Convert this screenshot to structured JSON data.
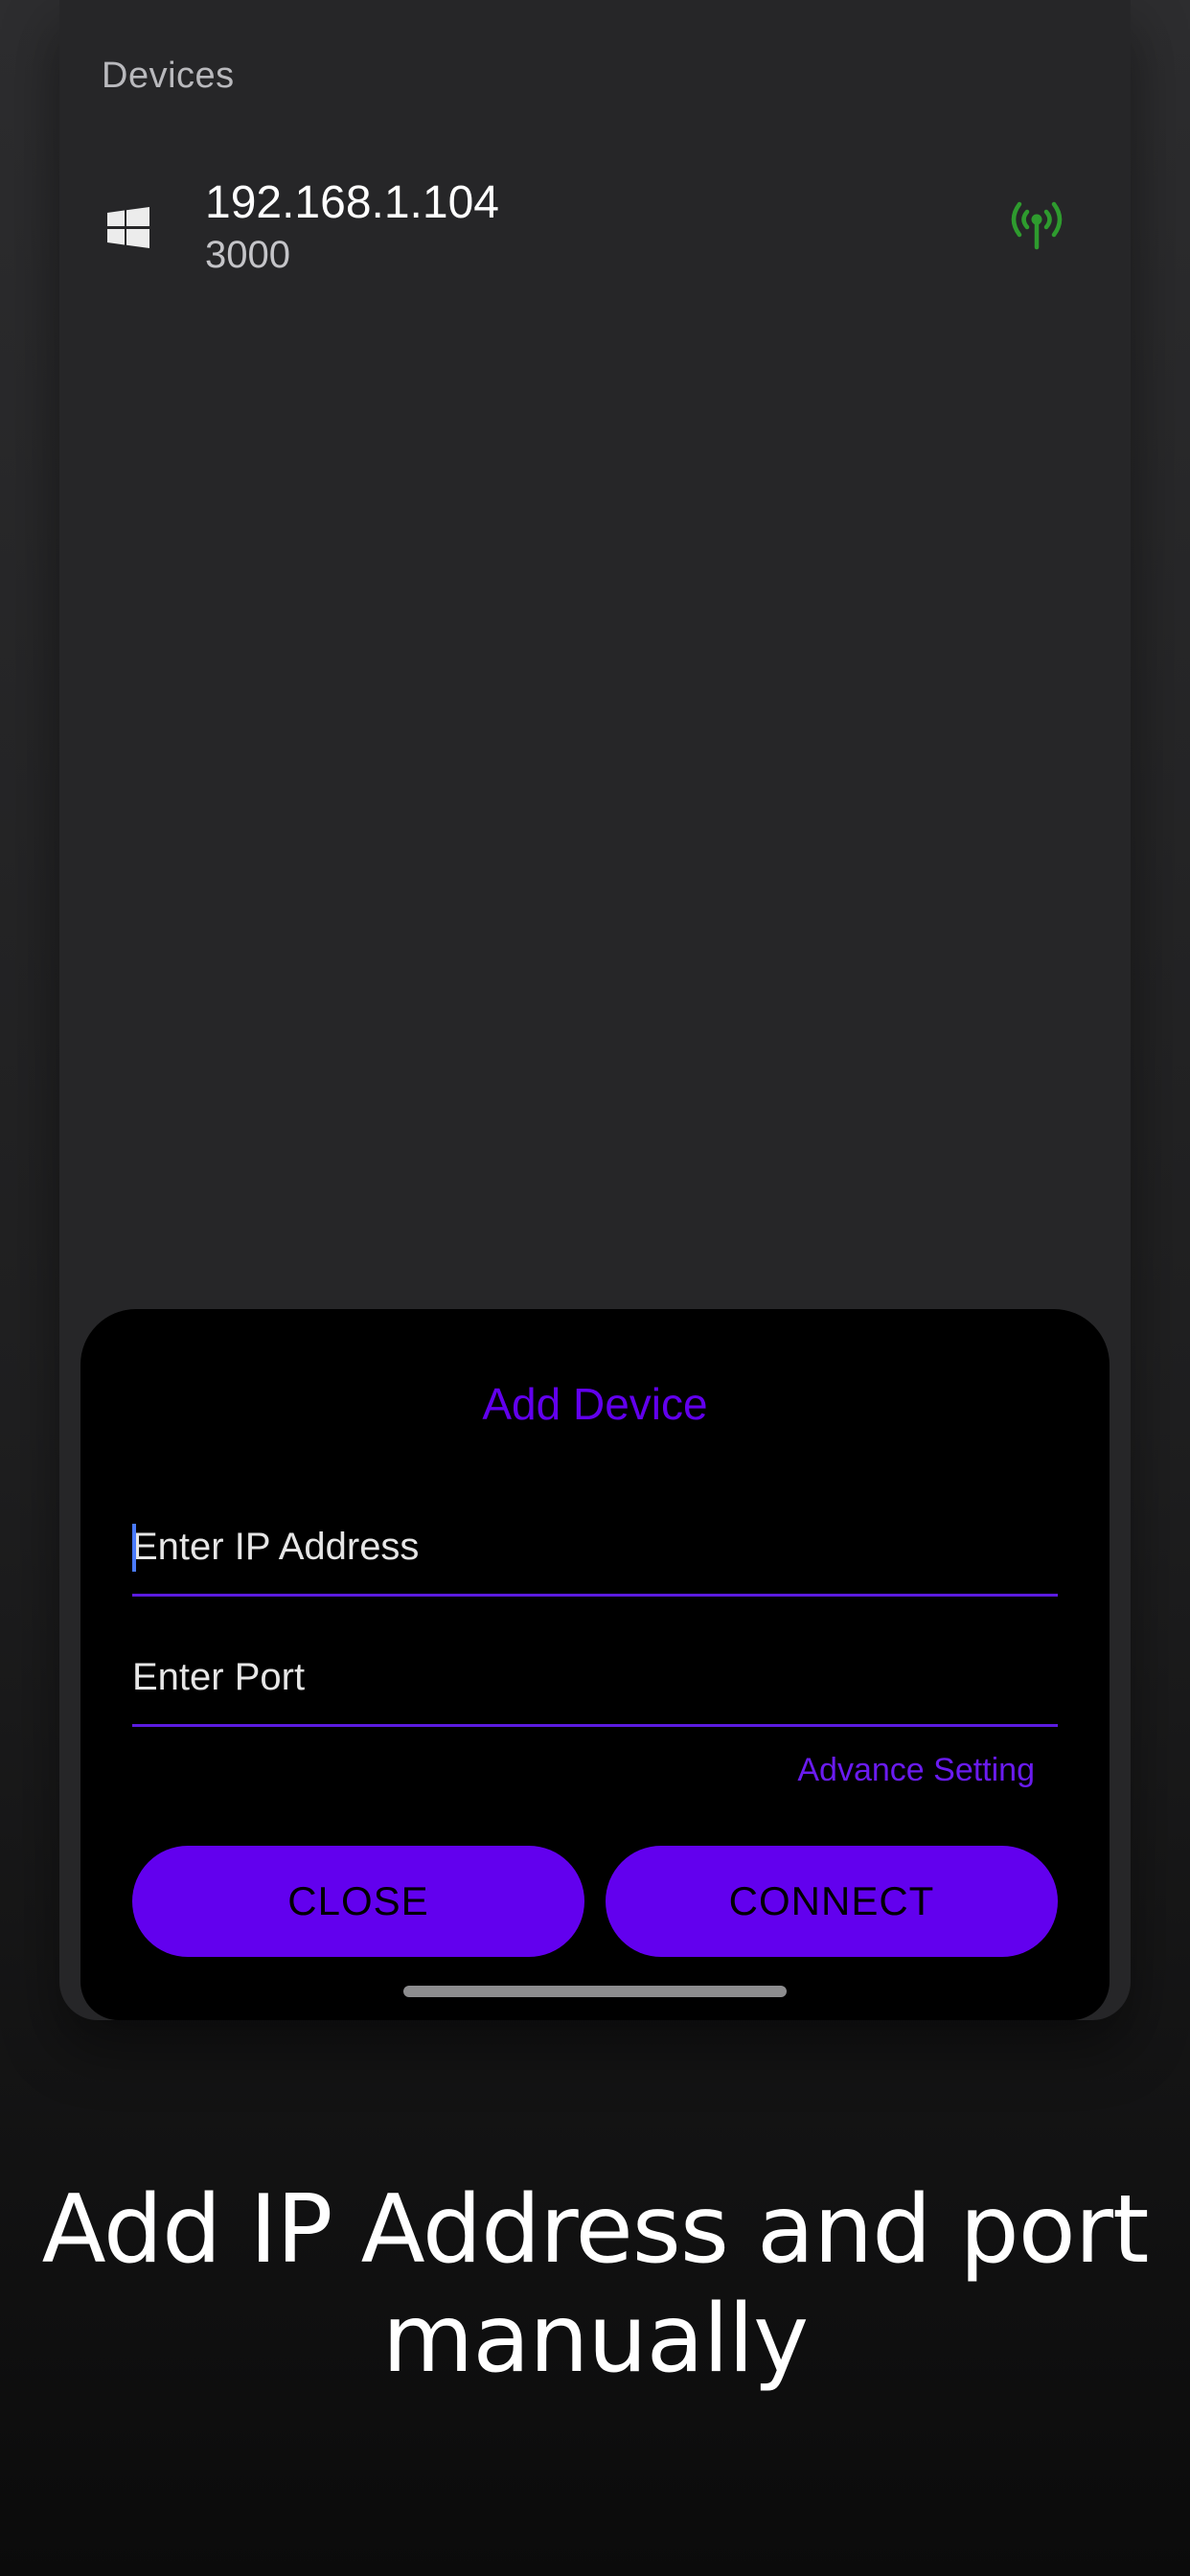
{
  "screen": {
    "section_title": "Devices"
  },
  "device": {
    "ip": "192.168.1.104",
    "port": "3000",
    "os_icon": "windows-icon",
    "status_icon": "signal-antenna-icon",
    "status_color": "#2e9b2e"
  },
  "dialog": {
    "title": "Add Device",
    "ip_placeholder": "Enter IP Address",
    "ip_value": "",
    "port_placeholder": "Enter Port",
    "port_value": "",
    "advance_setting": "Advance Setting",
    "close_label": "CLOSE",
    "connect_label": "CONNECT",
    "accent_color": "#6200ee"
  },
  "caption": {
    "line1": "Add IP Address and port",
    "line2": "manually"
  }
}
